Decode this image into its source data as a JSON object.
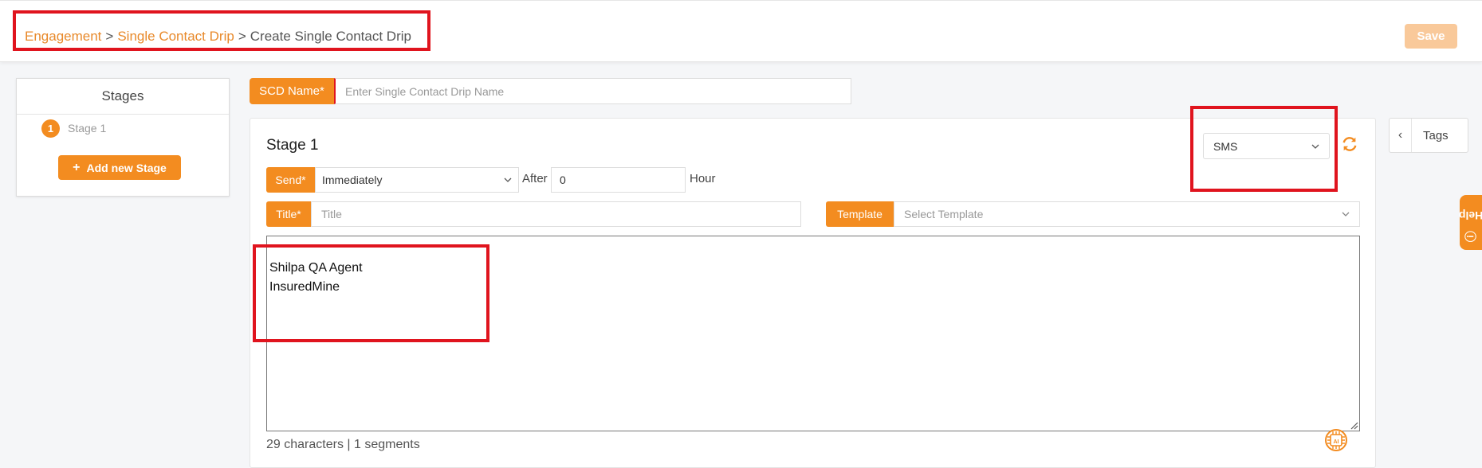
{
  "header": {
    "breadcrumb": [
      {
        "label": "Engagement"
      },
      {
        "label": "Single Contact Drip"
      },
      {
        "label": "Create Single Contact Drip"
      }
    ],
    "separator": ">",
    "save_label": "Save"
  },
  "stages_panel": {
    "title": "Stages",
    "items": [
      {
        "number": "1",
        "label": "Stage 1"
      }
    ],
    "add_label": "Add new Stage"
  },
  "scd_name": {
    "label": "SCD Name*",
    "placeholder": "Enter Single Contact Drip Name"
  },
  "stage": {
    "heading": "Stage 1",
    "channel": "SMS",
    "send_label": "Send*",
    "send_value": "Immediately",
    "after_label": "After",
    "after_value": "0",
    "hour_label": "Hour",
    "title_label": "Title*",
    "title_placeholder": "Title",
    "template_label": "Template",
    "template_placeholder": "Select Template",
    "message_lines": [
      "Shilpa QA Agent",
      "InsuredMine"
    ],
    "char_count": "29 characters | 1 segments"
  },
  "side": {
    "tags_label": "Tags",
    "help_label": "Help"
  },
  "colors": {
    "accent": "#f38c20",
    "highlight": "#e0141e"
  }
}
